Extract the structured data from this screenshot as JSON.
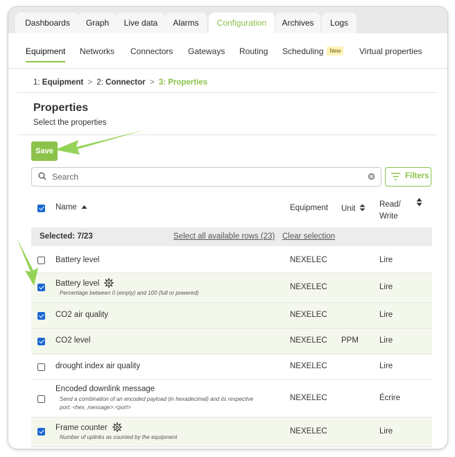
{
  "tabs": [
    "Dashboards",
    "Graph",
    "Live data",
    "Alarms",
    "Configuration",
    "Archives",
    "Logs"
  ],
  "active_tab": "Configuration",
  "subnav": {
    "items": [
      "Equipment",
      "Networks",
      "Connectors",
      "Gateways",
      "Routing",
      "Scheduling",
      "Virtual properties"
    ],
    "new_badge": "New",
    "active": "Equipment"
  },
  "breadcrumb": {
    "step1_num": "1:",
    "step1": "Equipment",
    "step2_num": "2:",
    "step2": "Connector",
    "step3_num": "3:",
    "step3": "Properties",
    "sep": ">"
  },
  "page": {
    "title": "Properties",
    "subtitle": "Select the properties",
    "save_label": "Save",
    "search_placeholder": "Search",
    "filters_label": "Filters"
  },
  "table": {
    "headers": {
      "name": "Name",
      "equipment": "Equipment",
      "unit": "Unit",
      "read_write_1": "Read/",
      "read_write_2": "Write"
    },
    "selection": {
      "selected": "Selected: 7/23",
      "select_all": "Select all available rows (23)",
      "clear": "Clear selection"
    },
    "rows": [
      {
        "name": "Battery level",
        "desc": "",
        "equipment": "NEXELEC",
        "unit": "",
        "rw": "Lire",
        "checked": false,
        "gear": false
      },
      {
        "name": "Battery level",
        "desc": "Percentage between 0 (empty) and 100 (full or powered)",
        "equipment": "NEXELEC",
        "unit": "",
        "rw": "Lire",
        "checked": true,
        "gear": true
      },
      {
        "name": "CO2 air quality",
        "desc": "",
        "equipment": "NEXELEC",
        "unit": "",
        "rw": "Lire",
        "checked": true,
        "gear": false
      },
      {
        "name": "CO2 level",
        "desc": "",
        "equipment": "NEXELEC",
        "unit": "PPM",
        "rw": "Lire",
        "checked": true,
        "gear": false
      },
      {
        "name": "drought index air quality",
        "desc": "",
        "equipment": "NEXELEC",
        "unit": "",
        "rw": "Lire",
        "checked": false,
        "gear": false
      },
      {
        "name": "Encoded downlink message",
        "desc": "Send a combination of an encoded payload (in hexadecimal) and its respective port: <hex_message>:<port>",
        "equipment": "NEXELEC",
        "unit": "",
        "rw": "Écrire",
        "checked": false,
        "gear": false
      },
      {
        "name": "Frame counter",
        "desc": "Number of uplinks as counted by the equipment",
        "equipment": "NEXELEC",
        "unit": "",
        "rw": "Lire",
        "checked": true,
        "gear": true
      }
    ]
  },
  "colors": {
    "accent": "#8bc34a",
    "checkbox": "#1a67d2",
    "selected_row": "#f4f8ec",
    "tabbar": "#e9e9e9"
  }
}
